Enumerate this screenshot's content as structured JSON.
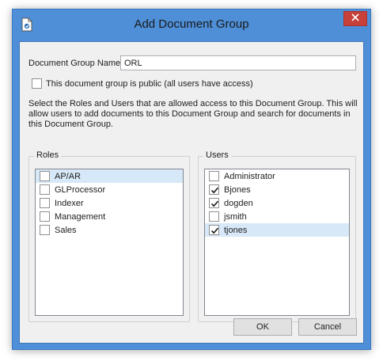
{
  "window": {
    "title": "Add Document Group",
    "close_glyph": "✕"
  },
  "form": {
    "group_name_label": "Document Group Name",
    "group_name_value": "ORL",
    "public_checkbox_label": "This document group is public (all users have access)",
    "public_checked": false,
    "instructions": "Select the Roles and Users that are allowed access to this Document Group.  This will allow users to add documents to this Document Group and search for documents in this Document Group."
  },
  "roles": {
    "legend": "Roles",
    "items": [
      {
        "label": "AP/AR",
        "checked": false,
        "selected": true
      },
      {
        "label": "GLProcessor",
        "checked": false,
        "selected": false
      },
      {
        "label": "Indexer",
        "checked": false,
        "selected": false
      },
      {
        "label": "Management",
        "checked": false,
        "selected": false
      },
      {
        "label": "Sales",
        "checked": false,
        "selected": false
      }
    ]
  },
  "users": {
    "legend": "Users",
    "items": [
      {
        "label": "Administrator",
        "checked": false,
        "selected": false
      },
      {
        "label": "Bjones",
        "checked": true,
        "selected": false
      },
      {
        "label": "dogden",
        "checked": true,
        "selected": false
      },
      {
        "label": "jsmith",
        "checked": false,
        "selected": false
      },
      {
        "label": "tjones",
        "checked": true,
        "selected": true
      }
    ]
  },
  "buttons": {
    "ok_label": "OK",
    "cancel_label": "Cancel"
  },
  "colors": {
    "title_bar": "#4e8fd8",
    "close_button": "#c7403a",
    "selected_row": "#d7e8f8"
  }
}
